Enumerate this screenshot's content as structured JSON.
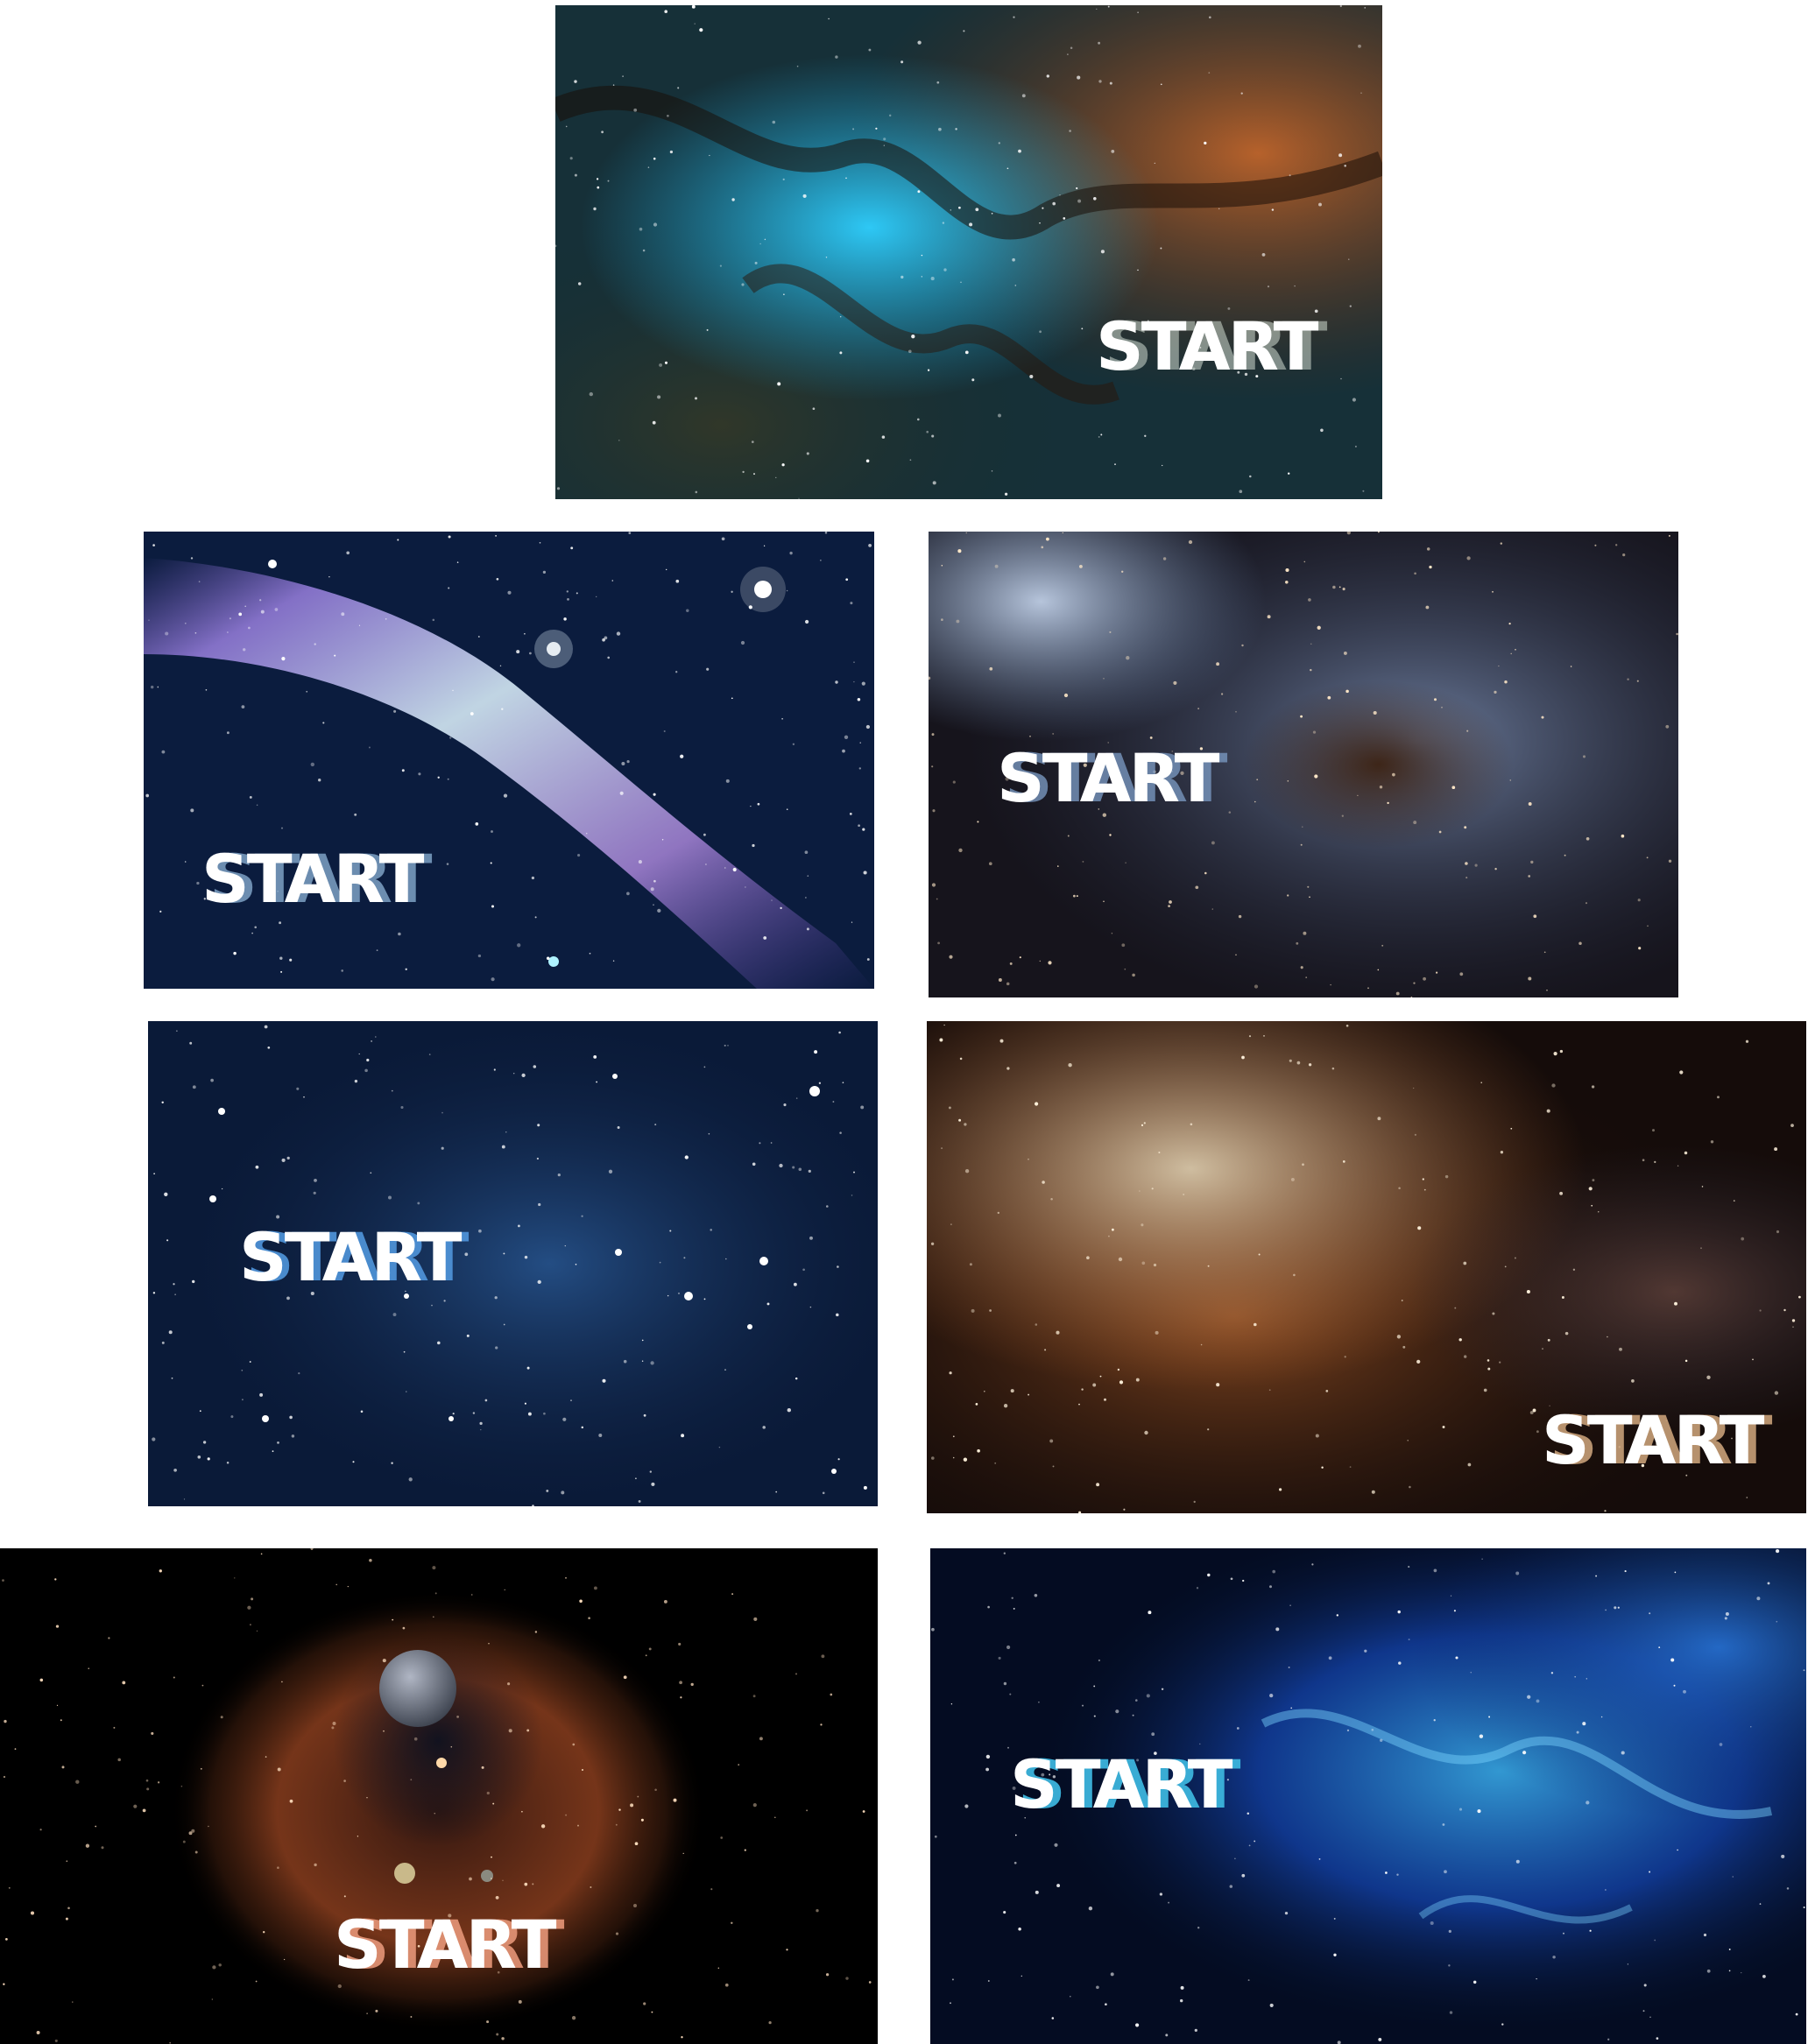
{
  "panels": [
    {
      "label": "START",
      "palette": [
        "#0f2b33",
        "#1fa8d8",
        "#c8672a",
        "#5a2a12"
      ]
    },
    {
      "label": "START",
      "palette": [
        "#0a1a3a",
        "#6a8be0",
        "#c08ae8",
        "#0c2848"
      ]
    },
    {
      "label": "START",
      "palette": [
        "#0d0c14",
        "#6f8db8",
        "#7a4a2a",
        "#c0c8d8"
      ]
    },
    {
      "label": "START",
      "palette": [
        "#081a35",
        "#1e4f8a",
        "#3a6ab0",
        "#0a1530"
      ]
    },
    {
      "label": "START",
      "palette": [
        "#1a0c08",
        "#b4612a",
        "#d8c0a0",
        "#2a2a3a"
      ]
    },
    {
      "label": "START",
      "palette": [
        "#000000",
        "#8a3e1e",
        "#d87a3a",
        "#1a1a22"
      ]
    },
    {
      "label": "START",
      "palette": [
        "#020814",
        "#1448b8",
        "#3ab0f0",
        "#082060"
      ]
    }
  ]
}
